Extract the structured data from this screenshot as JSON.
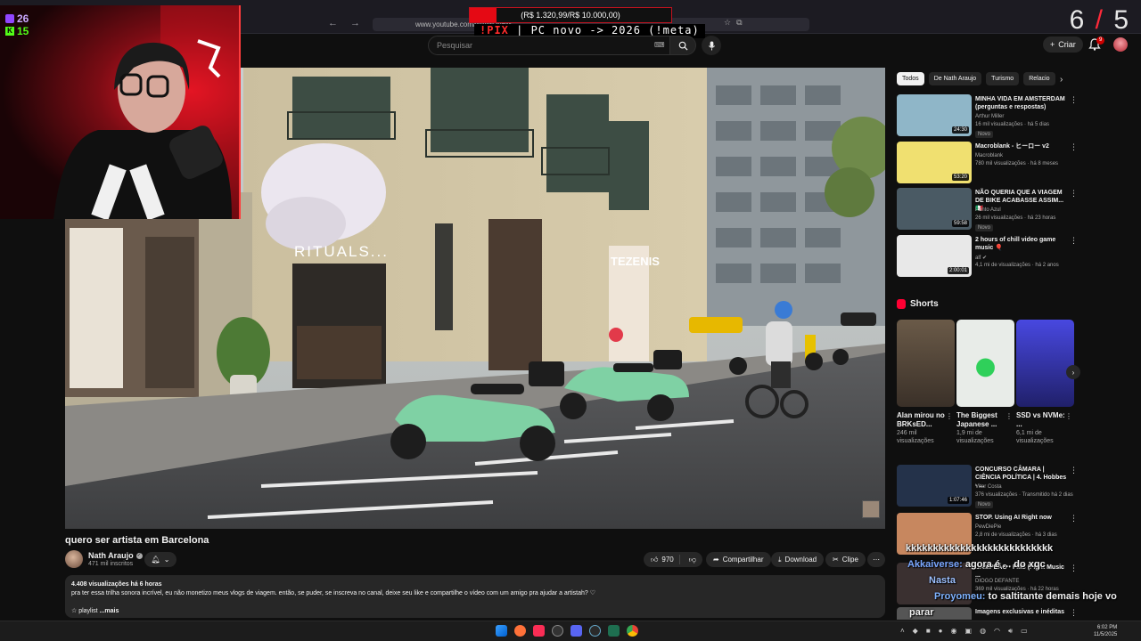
{
  "browser": {
    "url": "www.youtube.com/watch?v=M",
    "nav_back": "←",
    "nav_forward": "→",
    "nav_reload": "⟳"
  },
  "overlay": {
    "donation_text": "(R$ 1.320,99/R$ 10.000,00)",
    "donation_progress": 0.132,
    "pix_prefix": "!PIX",
    "pix_text": " | PC novo -> 2026 (!meta)",
    "score_left": "6",
    "score_sep": "/",
    "score_right": "5",
    "twitch_count": "26",
    "kick_count": "15"
  },
  "header": {
    "search_placeholder": "Pesquisar",
    "create_label": "Criar",
    "notif_count": "9"
  },
  "video": {
    "title": "quero ser artista em Barcelona",
    "channel": "Nath Araujo",
    "subs": "471 mil inscritos",
    "likes": "970",
    "share_label": "Compartilhar",
    "download_label": "Download",
    "clip_label": "Clipe",
    "desc_stats": "4.408 visualizações  há 6 horas",
    "desc_text": "pra ter essa trilha sonora incrível, eu não monetizo meus vlogs de viagem. então, se puder, se inscreva no canal, deixe seu like e compartilhe o vídeo com um amigo pra ajudar a artistah? ♡",
    "desc_playlist": "☆ playlist",
    "desc_more": "...mais",
    "scene_sign_rituals": "RITUALS...",
    "scene_sign_tezenis": "TEZENIS"
  },
  "chips": [
    "Todos",
    "De Nath Araujo",
    "Turismo",
    "Relacio"
  ],
  "recommended": [
    {
      "title": "MINHA VIDA EM AMSTERDAM (perguntas e respostas)",
      "channel": "Arthur Miller",
      "meta": "16 mil visualizações · há 5 dias",
      "badge": "Novo",
      "duration": "24:30",
      "color": "#8fb6c8"
    },
    {
      "title": "Macroblank - ヒーロー v2",
      "channel": "Macroblank",
      "meta": "780 mil visualizações · há 8 meses",
      "badge": "",
      "duration": "53:20",
      "color": "#f0e070"
    },
    {
      "title": "NÃO QUERIA QUE A VIAGEM DE BIKE ACABASSE ASSIM... 🇮🇹",
      "channel": "Ponto Azul",
      "meta": "26 mil visualizações · há 23 horas",
      "badge": "Novo",
      "duration": "59:58",
      "color": "#4a5a64"
    },
    {
      "title": "2 hours of chill video game music 🎈",
      "channel": "alf ✔",
      "meta": "4,1 mi de visualizações · há 2 anos",
      "badge": "",
      "duration": "2:00:01",
      "color": "#e8e8e8"
    }
  ],
  "shorts_label": "Shorts",
  "shorts": [
    {
      "title": "Alan mirou no BRKsED...",
      "views": "246 mil visualizações",
      "color": "#6a5a48"
    },
    {
      "title": "The Biggest Japanese ...",
      "views": "1,9 mi de visualizações",
      "color": "#d8e4d8"
    },
    {
      "title": "SSD vs NVMe: ...",
      "views": "6,1 mi de visualizações",
      "color": "#3c3cc8"
    }
  ],
  "more_recs": [
    {
      "title": "CONCURSO CÂMARA | CIÊNCIA POLÍTICA | 4. Hobbes - ...",
      "channel": "Vitor Costa",
      "meta": "376 visualizações · Transmitido há 2 dias",
      "badge": "Novo",
      "duration": "1:07:46",
      "color": "#24324a"
    },
    {
      "title": "STOP. Using AI Right now",
      "channel": "PewDiePie",
      "meta": "2,8 mi de visualizações · há 3 dias",
      "badge": "",
      "duration": "",
      "color": "#c7875f"
    },
    {
      "title": "CAMPEÃO - FMS (Fight Music ...",
      "channel": "DIOGO DEFANTE",
      "meta": "369 mil visualizações · há 22 horas",
      "badge": "",
      "duration": "",
      "color": "#3a3030"
    },
    {
      "title": "Imagens exclusivas e inéditas",
      "channel": "",
      "meta": "",
      "badge": "",
      "duration": "",
      "color": "#555"
    }
  ],
  "chat": [
    {
      "user": "",
      "msg": "kkkkkkkkkkkkkkkkkkkkkkkkkkk"
    },
    {
      "user": "Akkaiverse:",
      "msg": " agora é ... do xqc"
    },
    {
      "user": "Nasta",
      "msg": ""
    },
    {
      "user": "Proyomeu:",
      "msg": " to saltitante demais hoje vo"
    },
    {
      "user": "",
      "msg": "parar"
    }
  ],
  "taskbar": {
    "time": "6:02 PM",
    "date": "11/5/2025"
  }
}
